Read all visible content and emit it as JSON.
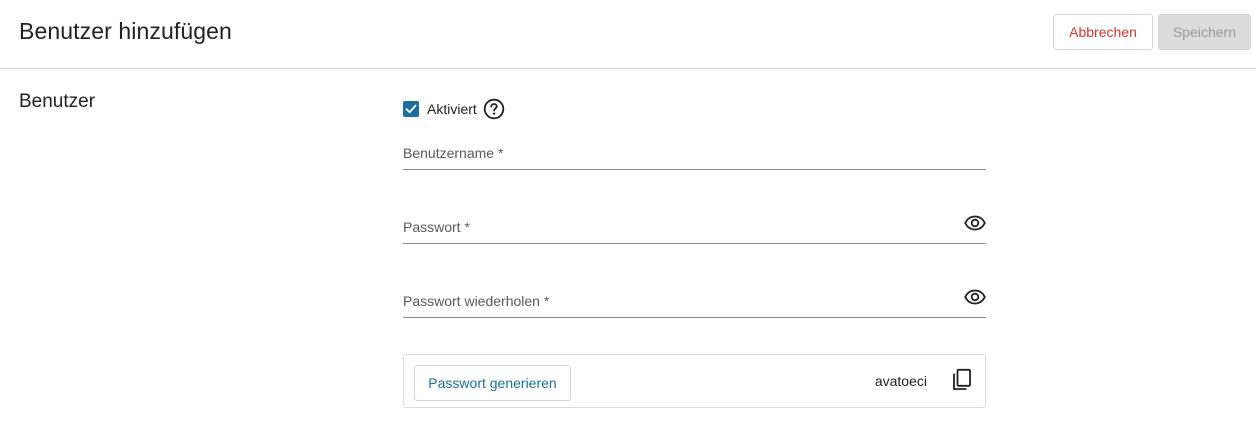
{
  "header": {
    "title": "Benutzer hinzufügen",
    "cancel_label": "Abbrechen",
    "save_label": "Speichern"
  },
  "section": {
    "title": "Benutzer"
  },
  "activated": {
    "label": "Aktiviert",
    "checked": true
  },
  "fields": {
    "username": {
      "placeholder": "Benutzername *",
      "value": ""
    },
    "password": {
      "placeholder": "Passwort *",
      "value": ""
    },
    "password_repeat": {
      "placeholder": "Passwort wiederholen *",
      "value": ""
    }
  },
  "generator": {
    "button_label": "Passwort generieren",
    "generated_password": "avatoeci"
  },
  "icons": {
    "checkbox": "check-icon",
    "help": "help-circle-icon",
    "toggle_visibility": "eye-icon",
    "copy": "copy-icon"
  },
  "colors": {
    "accent": "#1a6fa0",
    "danger": "#d9352b",
    "disabled_bg": "#dcdcdc",
    "disabled_text": "#9a9a9a"
  }
}
